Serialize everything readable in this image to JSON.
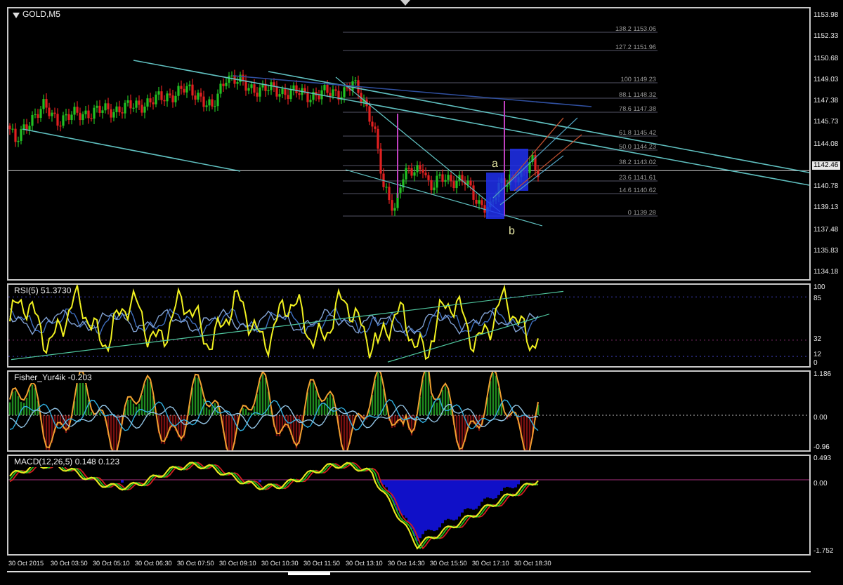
{
  "symbol_label": "GOLD,M5",
  "price_axis": [
    {
      "label": "1153.98",
      "current": false
    },
    {
      "label": "1152.33",
      "current": false
    },
    {
      "label": "1150.68",
      "current": false
    },
    {
      "label": "1149.03",
      "current": false
    },
    {
      "label": "1147.38",
      "current": false
    },
    {
      "label": "1145.73",
      "current": false
    },
    {
      "label": "1144.08",
      "current": false
    },
    {
      "label": "1142.46",
      "current": true
    },
    {
      "label": "1140.78",
      "current": false
    },
    {
      "label": "1139.13",
      "current": false
    },
    {
      "label": "1137.48",
      "current": false
    },
    {
      "label": "1135.83",
      "current": false
    },
    {
      "label": "1134.18",
      "current": false
    }
  ],
  "fib_levels": [
    "138.2 1153.06",
    "127.2 1151.96",
    "100 1149.23",
    "88.1 1148.32",
    "78.6 1147.38",
    "61.8 1145.42",
    "50.0 1144.23",
    "38.2 1143.02",
    "23.6 1141.61",
    "14.6 1140.62",
    "0 1139.28"
  ],
  "wave_labels": [
    "a",
    "b"
  ],
  "indicators": [
    {
      "kind": "rsi",
      "label": "RSI(5) 51.3730",
      "axis": [
        "100",
        "85",
        "32",
        "12",
        "0"
      ]
    },
    {
      "kind": "fisher",
      "label": "Fisher_Yur4ik -0.203",
      "axis": [
        "1.186",
        "0.00",
        "-0.96"
      ]
    },
    {
      "kind": "macd",
      "label": "MACD(12,26,5) 0.148 0.123",
      "axis": [
        "0.493",
        "0.00",
        "-1.752"
      ]
    }
  ],
  "time_axis": [
    "30 Oct 2015",
    "30 Oct 03:50",
    "30 Oct 05:10",
    "30 Oct 06:30",
    "30 Oct 07:50",
    "30 Oct 09:10",
    "30 Oct 10:30",
    "30 Oct 11:50",
    "30 Oct 13:10",
    "30 Oct 14:30",
    "30 Oct 15:50",
    "30 Oct 17:10",
    "30 Oct 18:30"
  ]
}
